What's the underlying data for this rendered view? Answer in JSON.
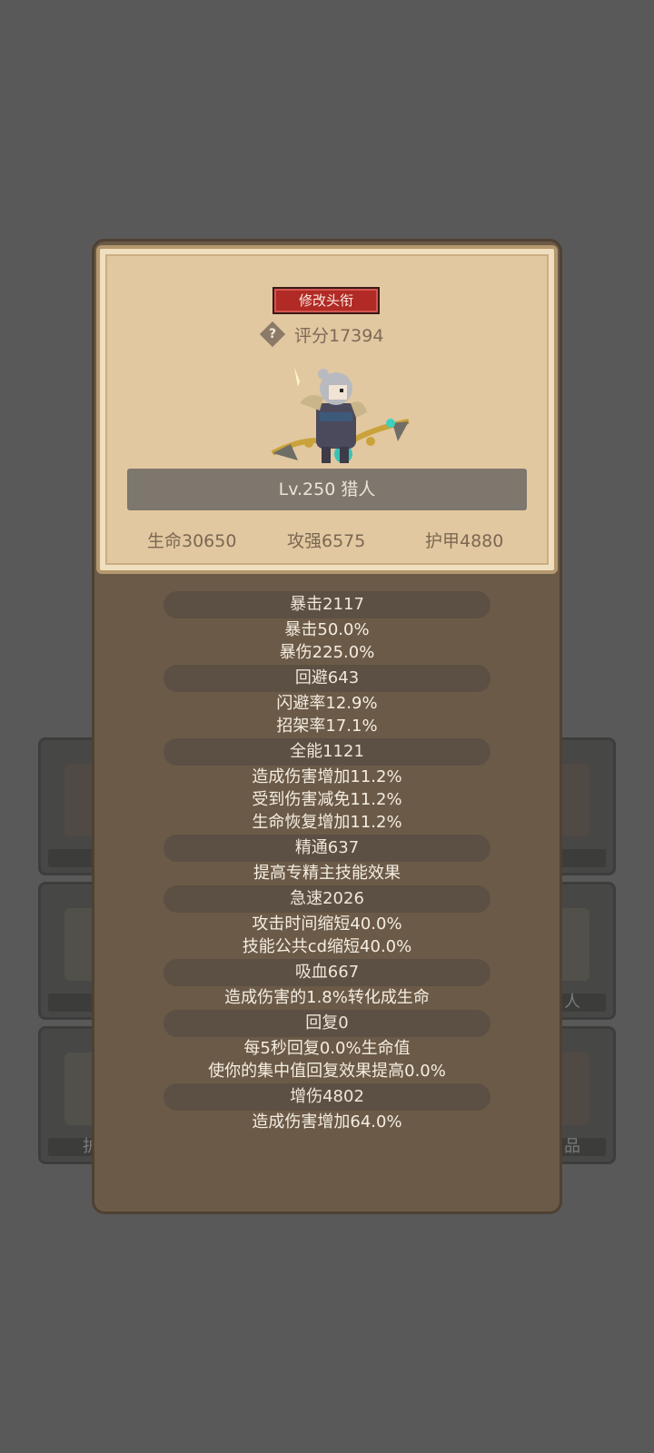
{
  "header": {
    "title_button": "修改头衔",
    "score": "评分17394",
    "help_icon": "question-diamond-icon",
    "level": "Lv.250 猎人"
  },
  "character": {
    "name": "hunter-sprite"
  },
  "main_stats": {
    "hp": "生命30650",
    "atk": "攻强6575",
    "armor": "护甲4880"
  },
  "background_slots": {
    "left_bottom_text": "护",
    "right_mid_text": "人",
    "right_bottom_text": "品"
  },
  "attributes": [
    {
      "name": "暴击2117",
      "lines": [
        "暴击50.0%",
        "暴伤225.0%"
      ]
    },
    {
      "name": "回避643",
      "lines": [
        "闪避率12.9%",
        "招架率17.1%"
      ]
    },
    {
      "name": "全能1121",
      "lines": [
        "造成伤害增加11.2%",
        "受到伤害减免11.2%",
        "生命恢复增加11.2%"
      ]
    },
    {
      "name": "精通637",
      "lines": [
        "提高专精主技能效果"
      ]
    },
    {
      "name": "急速2026",
      "lines": [
        "攻击时间缩短40.0%",
        "技能公共cd缩短40.0%"
      ]
    },
    {
      "name": "吸血667",
      "lines": [
        "造成伤害的1.8%转化成生命"
      ]
    },
    {
      "name": "回复0",
      "lines": [
        "每5秒回复0.0%生命值",
        "使你的集中值回复效果提高0.0%"
      ]
    },
    {
      "name": "增伤4802",
      "lines": [
        "造成伤害增加64.0%"
      ]
    }
  ],
  "colors": {
    "background": "#595959",
    "panel": "#6b5a47",
    "card": "#e2c8a0",
    "title_button": "#b12a25"
  }
}
